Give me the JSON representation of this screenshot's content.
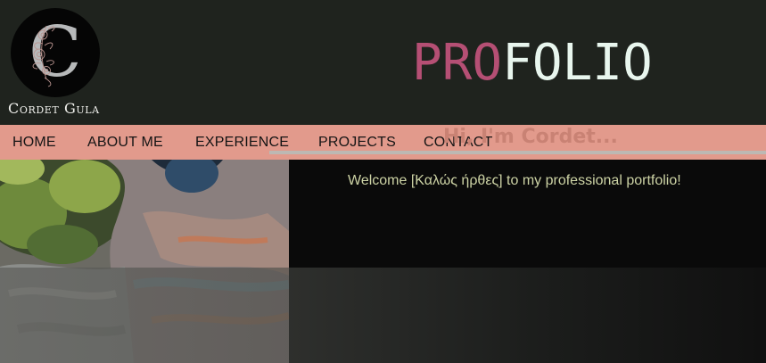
{
  "header": {
    "owner_name": "Cordet Gula",
    "logo_icon": "monogram-c-floral-logo",
    "brand_pro": "PRO",
    "brand_folio": "FOLIO"
  },
  "nav": {
    "items": [
      {
        "label": "HOME"
      },
      {
        "label": "ABOUT ME"
      },
      {
        "label": "EXPERIENCE"
      },
      {
        "label": "PROJECTS"
      },
      {
        "label": "CONTACT"
      }
    ]
  },
  "hero": {
    "image": "rainbow-eucalyptus-tree-photo",
    "title": "Hi, I'm Cordet...",
    "welcome": "Welcome [Καλώς ήρθες] to my professional portfolio!"
  },
  "colors": {
    "header_bg": "#1f231e",
    "nav_bg": "#e29a8c",
    "brand_accent": "#b54f74",
    "brand_light": "#e8f6ee",
    "title_color": "#c98274",
    "welcome_color": "#cdd3a5"
  }
}
